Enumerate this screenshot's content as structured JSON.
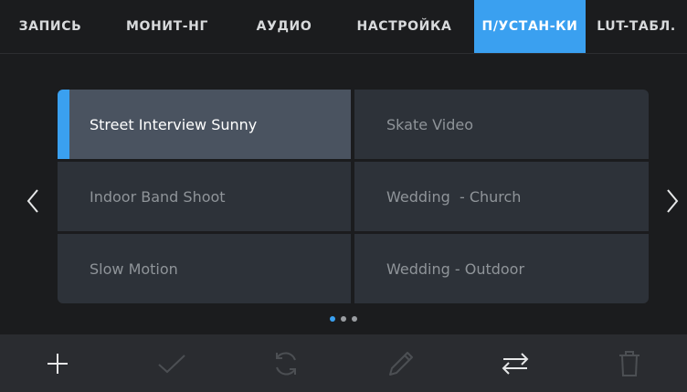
{
  "tabs": [
    {
      "label": "ЗАПИСЬ",
      "active": false
    },
    {
      "label": "МОНИТ-НГ",
      "active": false
    },
    {
      "label": "АУДИО",
      "active": false
    },
    {
      "label": "НАСТРОЙКА",
      "active": false
    },
    {
      "label": "П/УСТАН-КИ",
      "active": true
    },
    {
      "label": "LUT-ТАБЛ.",
      "active": false
    }
  ],
  "presets": [
    {
      "label": "Street Interview Sunny",
      "selected": true
    },
    {
      "label": "Skate Video",
      "selected": false
    },
    {
      "label": "Indoor Band Shoot",
      "selected": false
    },
    {
      "label": "Wedding  - Church",
      "selected": false
    },
    {
      "label": "Slow Motion",
      "selected": false
    },
    {
      "label": "Wedding - Outdoor",
      "selected": false
    }
  ],
  "pagination": {
    "pages": 3,
    "current": 1
  },
  "toolbar": [
    {
      "icon": "plus-icon",
      "enabled": true
    },
    {
      "icon": "check-icon",
      "enabled": false
    },
    {
      "icon": "refresh-icon",
      "enabled": false
    },
    {
      "icon": "pencil-icon",
      "enabled": false
    },
    {
      "icon": "swap-arrows-icon",
      "enabled": true
    },
    {
      "icon": "trash-icon",
      "enabled": false
    }
  ],
  "colors": {
    "accent": "#3aa0f0",
    "background": "#1b1c1e",
    "cell": "#2d3239",
    "cell_selected": "#4a5360",
    "toolbar": "#2a2c30"
  }
}
